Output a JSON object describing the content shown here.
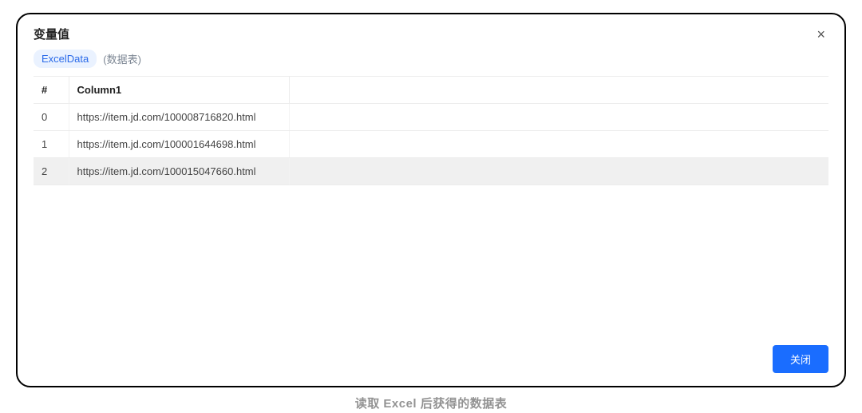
{
  "modal": {
    "title": "变量值",
    "close_glyph": "×",
    "variable_name": "ExcelData",
    "variable_type": "(数据表)",
    "close_button_label": "关闭"
  },
  "table": {
    "headers": {
      "index": "#",
      "col1": "Column1"
    },
    "rows": [
      {
        "index": "0",
        "col1": "https://item.jd.com/100008716820.html",
        "selected": false
      },
      {
        "index": "1",
        "col1": "https://item.jd.com/100001644698.html",
        "selected": false
      },
      {
        "index": "2",
        "col1": "https://item.jd.com/100015047660.html",
        "selected": true
      }
    ]
  },
  "caption": "读取 Excel 后获得的数据表"
}
